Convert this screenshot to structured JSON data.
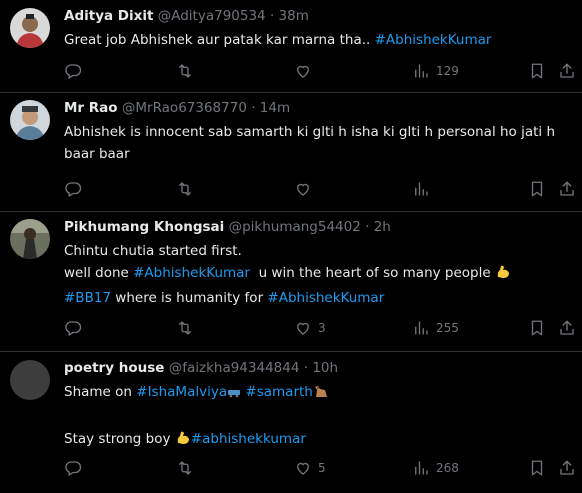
{
  "tweets": [
    {
      "name": "Aditya Dixit",
      "handle": "@Aditya790534",
      "separator": "·",
      "time": "38m",
      "text_plain": "Great job Abhishek aur patak kar marna tha.. ",
      "text_tag": "#AbhishekKumar",
      "counts": {
        "reply": "",
        "retweet": "",
        "like": "",
        "views": "129"
      }
    },
    {
      "name": "Mr Rao",
      "handle": "@MrRao67368770",
      "separator": "·",
      "time": "14m",
      "text_plain": "Abhishek is innocent sab samarth ki glti h isha ki glti h personal ho jati h baar baar",
      "counts": {
        "reply": "",
        "retweet": "",
        "like": "",
        "views": ""
      }
    },
    {
      "name": "Pikhumang Khongsai",
      "handle": "@pikhumang54402",
      "separator": "·",
      "time": "2h",
      "line1": "Chintu chutia started first.",
      "line2_a": "well done ",
      "line2_tag": "#AbhishekKumar",
      "line2_b": "  u win the heart of so many people ",
      "line3_tag1": "#BB17",
      "line3_mid": " where is humanity for ",
      "line3_tag2": "#AbhishekKumar",
      "counts": {
        "reply": "",
        "retweet": "",
        "like": "3",
        "views": "255"
      }
    },
    {
      "name": "poetry house",
      "handle": "@faizkha94344844",
      "separator": "·",
      "time": "10h",
      "line1_a": "Shame on ",
      "line1_tag1": "#IshaMalviya",
      "line1_tag2": "#samarth",
      "line3_a": "Stay strong boy ",
      "line3_tag": "#abhishekkumar",
      "counts": {
        "reply": "",
        "retweet": "",
        "like": "5",
        "views": "268"
      }
    }
  ],
  "icons": [
    "reply-icon",
    "retweet-icon",
    "like-icon",
    "views-icon",
    "bookmark-icon",
    "share-icon"
  ],
  "colors": {
    "background": "#000000",
    "text": "#e7e9ea",
    "muted": "#71767b",
    "link": "#1d9bf0",
    "divider": "#2f3336"
  }
}
